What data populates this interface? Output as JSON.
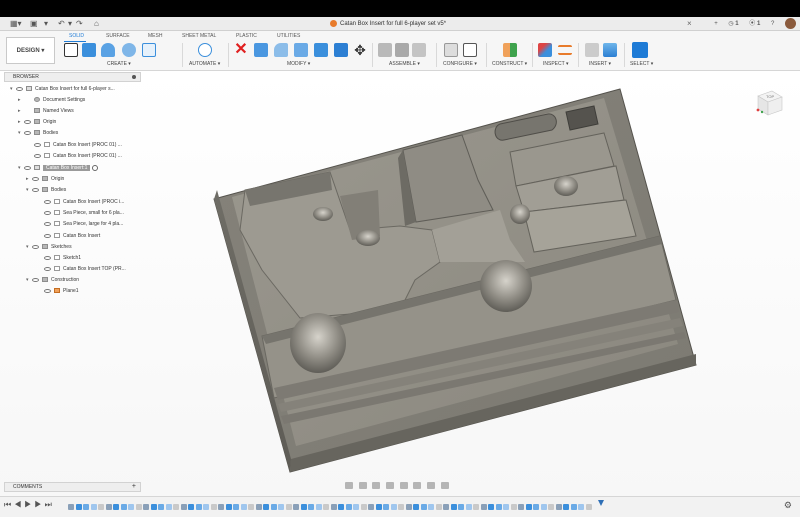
{
  "window": {
    "document_tab": "Catan Box Insert for full 6-player set v5*",
    "close_symbol": "×",
    "add_tab_symbol": "+"
  },
  "topbar": {
    "job_count": "1",
    "notification_count": "1",
    "icons": [
      "grid-icon",
      "save-icon",
      "undo-icon",
      "redo-icon",
      "home-icon",
      "clock-icon",
      "help-icon",
      "avatar"
    ]
  },
  "toolbar": {
    "workspace": "DESIGN ▾",
    "tabs": [
      "SOLID",
      "SURFACE",
      "MESH",
      "SHEET METAL",
      "PLASTIC",
      "UTILITIES"
    ],
    "active_tab": "SOLID",
    "groups": [
      "CREATE ▾",
      "AUTOMATE ▾",
      "MODIFY ▾",
      "ASSEMBLE ▾",
      "CONFIGURE ▾",
      "CONSTRUCT ▾",
      "INSPECT ▾",
      "INSERT ▾",
      "SELECT ▾"
    ],
    "colors": {
      "accent": "#1e7bd6",
      "delete": "#e02020"
    }
  },
  "browser": {
    "title": "BROWSER",
    "items": [
      {
        "label": "Catan Box Insert for full 6-player s...",
        "icon": "document-icon"
      },
      {
        "label": "Document Settings",
        "icon": "gear-icon"
      },
      {
        "label": "Named Views",
        "icon": "folder-icon"
      },
      {
        "label": "Origin",
        "icon": "folder-icon"
      },
      {
        "label": "Bodies",
        "icon": "folder-icon"
      },
      {
        "label": "Catan Box Insert (PROC 01) ...",
        "icon": "body-icon"
      },
      {
        "label": "Catan Box Insert (PROC 01) ...",
        "icon": "body-icon"
      },
      {
        "label": "Catan Box Insert:1",
        "icon": "component-icon"
      },
      {
        "label": "Origin",
        "icon": "folder-icon"
      },
      {
        "label": "Bodies",
        "icon": "folder-icon"
      },
      {
        "label": "Catan Box Insert (PROC i...",
        "icon": "body-icon"
      },
      {
        "label": "Sea Piece, small for 6 pla...",
        "icon": "body-icon"
      },
      {
        "label": "Sea Piece, large for 4 pla...",
        "icon": "body-icon"
      },
      {
        "label": "Catan Box Insert",
        "icon": "body-icon"
      },
      {
        "label": "Sketches",
        "icon": "folder-icon"
      },
      {
        "label": "Sketch1",
        "icon": "sketch-icon"
      },
      {
        "label": "Catan Box Insert TOP (PR...",
        "icon": "sketch-icon"
      },
      {
        "label": "Construction",
        "icon": "folder-icon"
      },
      {
        "label": "Plane1",
        "icon": "plane-icon"
      }
    ]
  },
  "comments": {
    "title": "COMMENTS",
    "add": "+"
  },
  "viewcube": {
    "face": "TOP"
  },
  "model": {
    "color": "#8a877c",
    "name": "Catan Box Insert"
  }
}
